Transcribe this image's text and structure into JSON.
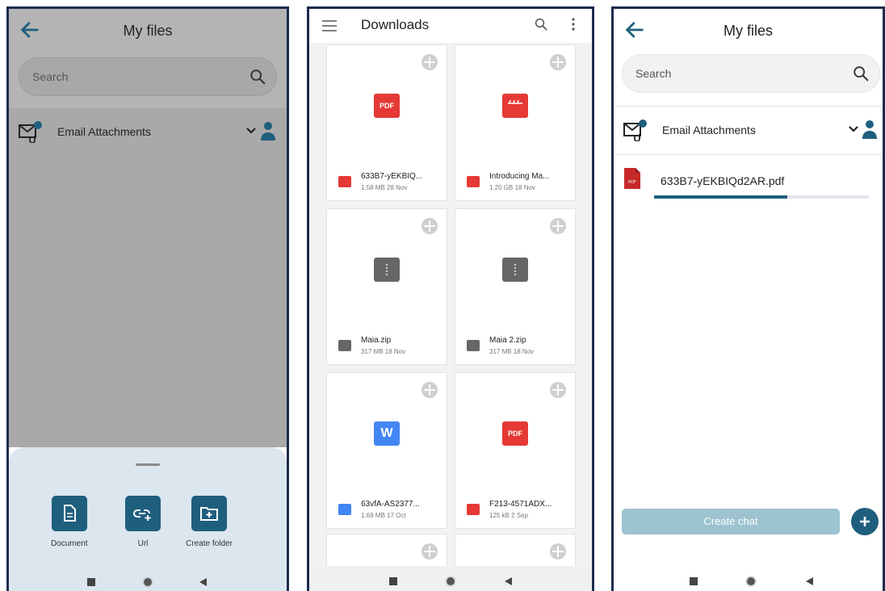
{
  "colors": {
    "brand": "#1f5f7e",
    "pdf_red": "#e53935",
    "word_blue": "#4285f4",
    "zip_gray": "#666666"
  },
  "screen1": {
    "title": "My files",
    "search": {
      "placeholder": "Search"
    },
    "folder": {
      "label": "Email Attachments",
      "badge": "0"
    },
    "sheet": {
      "actions": [
        {
          "label": "Document",
          "icon": "document-icon"
        },
        {
          "label": "Url",
          "icon": "link-add-icon"
        },
        {
          "label": "Create folder",
          "icon": "folder-add-icon"
        }
      ]
    }
  },
  "screen2": {
    "title": "Downloads",
    "files": [
      {
        "name": "633B7-yEKBIQ...",
        "meta": "1.58 MB 28 Nov",
        "type": "pdf",
        "icon_text": "PDF"
      },
      {
        "name": "Introducing Ma...",
        "meta": "1.20 GB 18 Nov",
        "type": "video",
        "icon_text": ""
      },
      {
        "name": "Maia.zip",
        "meta": "317 MB 18 Nov",
        "type": "zip",
        "icon_text": ""
      },
      {
        "name": "Maia 2.zip",
        "meta": "317 MB 18 Nov",
        "type": "zip",
        "icon_text": ""
      },
      {
        "name": "63vfA-AS2377...",
        "meta": "1.69 MB 17 Oct",
        "type": "word",
        "icon_text": "W"
      },
      {
        "name": "F213-4571ADX...",
        "meta": "125 kB 2 Sep",
        "type": "pdf",
        "icon_text": "PDF"
      }
    ]
  },
  "screen3": {
    "title": "My files",
    "search": {
      "placeholder": "Search"
    },
    "folder": {
      "label": "Email Attachments",
      "badge": "0"
    },
    "file": {
      "name": "633B7-yEKBIQd2AR.pdf",
      "progress": 0.62
    },
    "create_chat_label": "Create chat"
  }
}
